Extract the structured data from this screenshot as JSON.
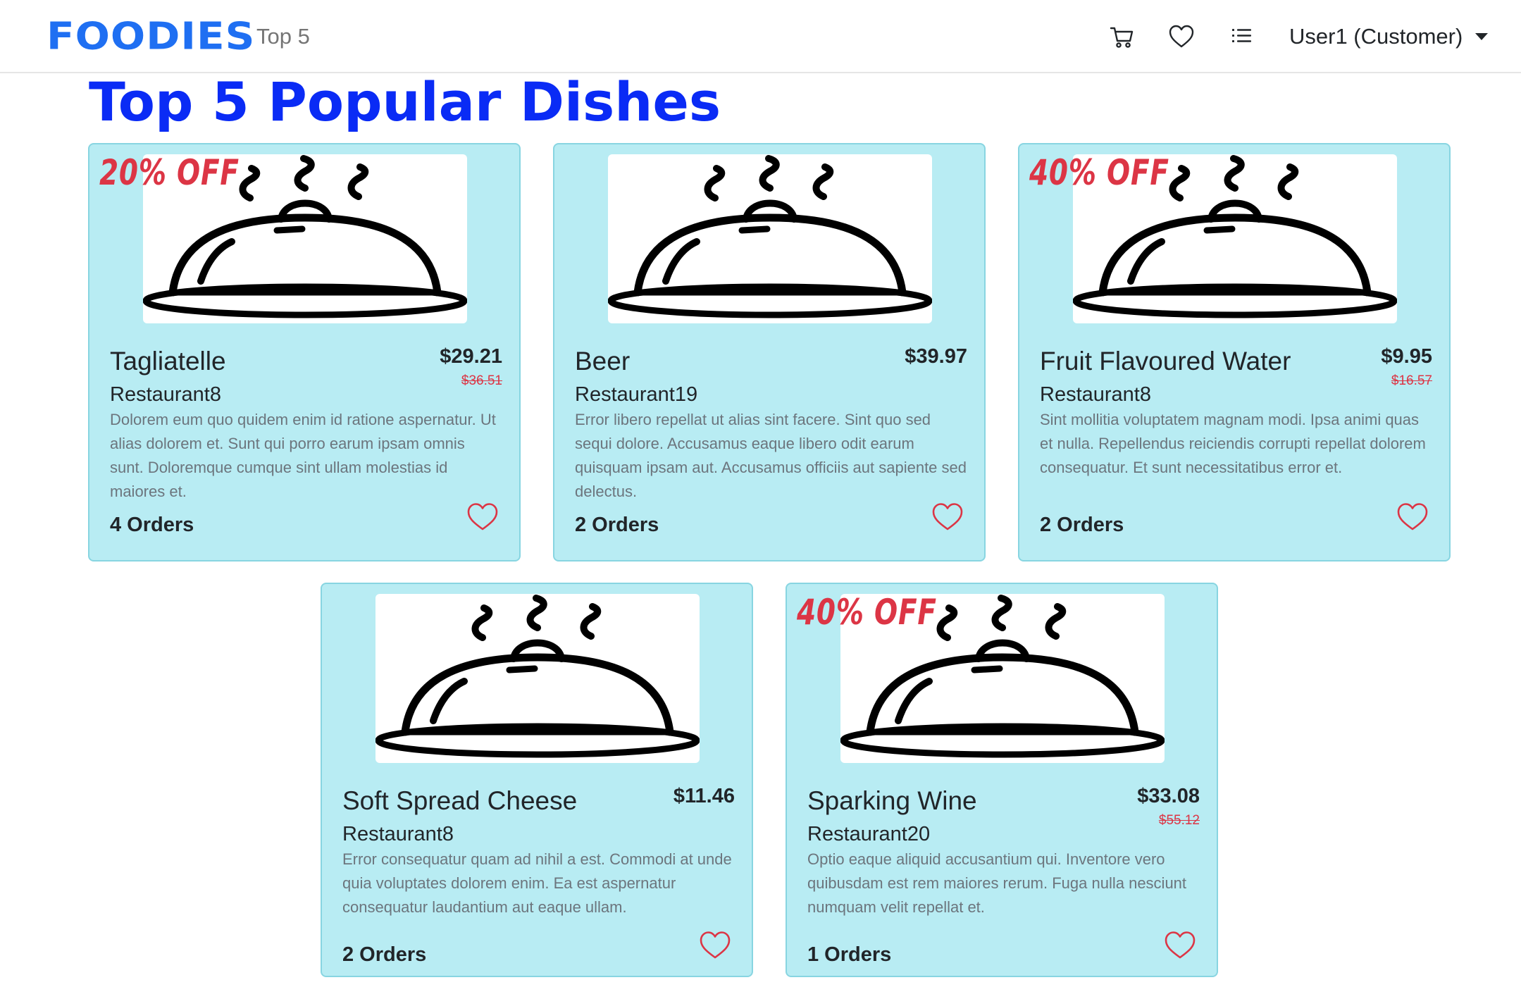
{
  "navbar": {
    "brand": "FOODIES",
    "link_top5": "Top 5",
    "icons": [
      "cart-icon",
      "heart-icon",
      "list-icon"
    ],
    "user_menu": "User1 (Customer)"
  },
  "page": {
    "title": "Top 5 Popular Dishes"
  },
  "colors": {
    "brand": "#1f6ff2",
    "title": "#0a2bf5",
    "card_bg": "#b8ecf3",
    "discount": "#dc3545",
    "heart": "#dc3545"
  },
  "cards": [
    {
      "discount": "20% OFF",
      "name": "Tagliatelle",
      "price": "$29.21",
      "old_price": "$36.51",
      "restaurant": "Restaurant8",
      "description": "Dolorem eum quo quidem enim id ratione aspernatur. Ut alias dolorem et. Sunt qui porro earum ipsam omnis sunt. Doloremque cumque sint ullam molestias id maiores et.",
      "orders": "4 Orders"
    },
    {
      "discount": "",
      "name": "Beer",
      "price": "$39.97",
      "old_price": "",
      "restaurant": "Restaurant19",
      "description": "Error libero repellat ut alias sint facere. Sint quo sed sequi dolore. Accusamus eaque libero odit earum quisquam ipsam aut. Accusamus officiis aut sapiente sed delectus.",
      "orders": "2 Orders"
    },
    {
      "discount": "40% OFF",
      "name": "Fruit Flavoured Water",
      "price": "$9.95",
      "old_price": "$16.57",
      "restaurant": "Restaurant8",
      "description": "Sint mollitia voluptatem magnam modi. Ipsa animi quas et nulla. Repellendus reiciendis corrupti repellat dolorem consequatur. Et sunt necessitatibus error et.",
      "orders": "2 Orders"
    },
    {
      "discount": "",
      "name": "Soft Spread Cheese",
      "price": "$11.46",
      "old_price": "",
      "restaurant": "Restaurant8",
      "description": "Error consequatur quam ad nihil a est. Commodi at unde quia voluptates dolorem enim. Ea est aspernatur consequatur laudantium aut eaque ullam.",
      "orders": "2 Orders"
    },
    {
      "discount": "40% OFF",
      "name": "Sparking Wine",
      "price": "$33.08",
      "old_price": "$55.12",
      "restaurant": "Restaurant20",
      "description": "Optio eaque aliquid accusantium qui. Inventore vero quibusdam est rem maiores rerum. Fuga nulla nesciunt numquam velit repellat et.",
      "orders": "1 Orders"
    }
  ]
}
